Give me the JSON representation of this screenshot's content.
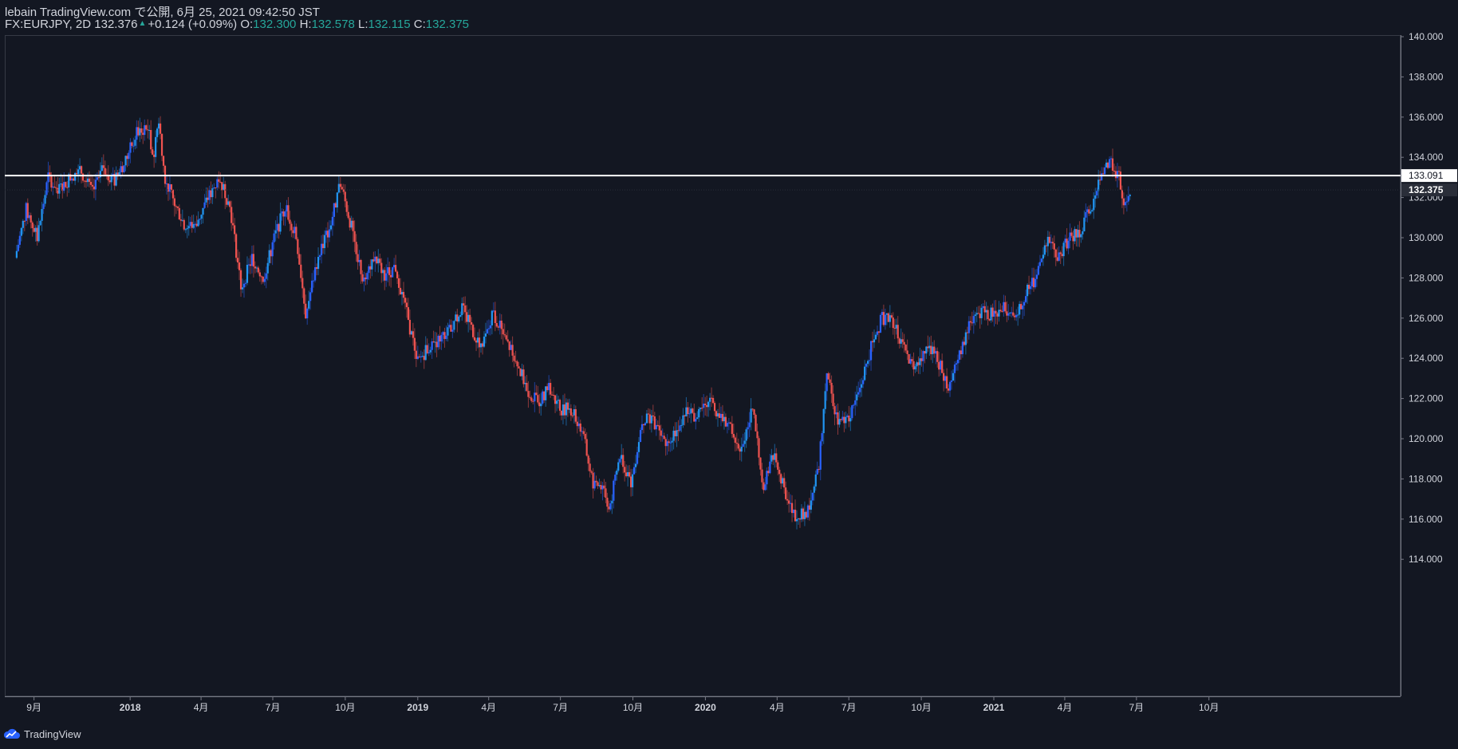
{
  "header": {
    "published_line": "lebain TradingView.com で公開, 6月 25, 2021 09:42:50 JST",
    "symbol": "FX:EURJPY, 2D",
    "last": "132.376",
    "change": "+0.124 (+0.09%)",
    "o_label": "O:",
    "o_value": "132.300",
    "h_label": "H:",
    "h_value": "132.578",
    "l_label": "L:",
    "l_value": "132.115",
    "c_label": "C:",
    "c_value": "132.375"
  },
  "footer": {
    "brand": "TradingView"
  },
  "colors": {
    "background": "#131722",
    "up": "#2962ff",
    "up_alt": "#2196f3",
    "down": "#ef5350",
    "text": "#d1d4dc",
    "teal": "#26a69a",
    "hline": "#ffffff"
  },
  "chart_data": {
    "type": "candlestick",
    "symbol": "FX:EURJPY",
    "interval": "2D",
    "ylim": [
      112.5,
      140.5
    ],
    "y_ticks": [
      "140.000",
      "138.000",
      "136.000",
      "134.000",
      "132.000",
      "130.000",
      "128.000",
      "126.000",
      "124.000",
      "122.000",
      "120.000",
      "118.000",
      "116.000",
      "114.000"
    ],
    "x_ticks": [
      {
        "label": "9月",
        "date": "2017-09",
        "bold": false
      },
      {
        "label": "2018",
        "date": "2018-01",
        "bold": true
      },
      {
        "label": "4月",
        "date": "2018-04",
        "bold": false
      },
      {
        "label": "7月",
        "date": "2018-07",
        "bold": false
      },
      {
        "label": "10月",
        "date": "2018-10",
        "bold": false
      },
      {
        "label": "2019",
        "date": "2019-01",
        "bold": true
      },
      {
        "label": "4月",
        "date": "2019-04",
        "bold": false
      },
      {
        "label": "7月",
        "date": "2019-07",
        "bold": false
      },
      {
        "label": "10月",
        "date": "2019-10",
        "bold": false
      },
      {
        "label": "2020",
        "date": "2020-01",
        "bold": true
      },
      {
        "label": "4月",
        "date": "2020-04",
        "bold": false
      },
      {
        "label": "7月",
        "date": "2020-07",
        "bold": false
      },
      {
        "label": "10月",
        "date": "2020-10",
        "bold": false
      },
      {
        "label": "2021",
        "date": "2021-01",
        "bold": true
      },
      {
        "label": "4月",
        "date": "2021-04",
        "bold": false
      },
      {
        "label": "7月",
        "date": "2021-07",
        "bold": false
      },
      {
        "label": "10月",
        "date": "2021-10",
        "bold": false
      }
    ],
    "horizontal_line": {
      "value": 133.091,
      "label": "133.091"
    },
    "last_price": {
      "value": 132.375,
      "label": "132.375"
    },
    "anchors": [
      [
        "2017-08-10",
        129.0
      ],
      [
        "2017-08-24",
        131.4
      ],
      [
        "2017-09-07",
        130.0
      ],
      [
        "2017-09-21",
        133.0
      ],
      [
        "2017-10-05",
        132.4
      ],
      [
        "2017-10-19",
        133.0
      ],
      [
        "2017-11-02",
        133.3
      ],
      [
        "2017-11-16",
        132.2
      ],
      [
        "2017-11-30",
        133.5
      ],
      [
        "2017-12-14",
        132.8
      ],
      [
        "2017-12-28",
        133.8
      ],
      [
        "2018-01-11",
        135.2
      ],
      [
        "2018-01-25",
        135.5
      ],
      [
        "2018-02-02",
        134.0
      ],
      [
        "2018-02-08",
        136.0
      ],
      [
        "2018-02-16",
        133.0
      ],
      [
        "2018-03-01",
        131.6
      ],
      [
        "2018-03-15",
        130.5
      ],
      [
        "2018-03-29",
        130.8
      ],
      [
        "2018-04-12",
        132.0
      ],
      [
        "2018-04-26",
        133.0
      ],
      [
        "2018-05-10",
        131.5
      ],
      [
        "2018-05-24",
        127.5
      ],
      [
        "2018-06-07",
        129.0
      ],
      [
        "2018-06-21",
        128.0
      ],
      [
        "2018-07-05",
        130.0
      ],
      [
        "2018-07-19",
        131.6
      ],
      [
        "2018-08-02",
        130.0
      ],
      [
        "2018-08-14",
        126.2
      ],
      [
        "2018-08-30",
        129.2
      ],
      [
        "2018-09-13",
        130.5
      ],
      [
        "2018-09-27",
        132.7
      ],
      [
        "2018-10-11",
        130.5
      ],
      [
        "2018-10-25",
        128.0
      ],
      [
        "2018-11-08",
        129.0
      ],
      [
        "2018-11-22",
        128.2
      ],
      [
        "2018-12-06",
        128.5
      ],
      [
        "2018-12-20",
        126.2
      ],
      [
        "2019-01-03",
        123.8
      ],
      [
        "2019-01-17",
        124.6
      ],
      [
        "2019-01-31",
        125.0
      ],
      [
        "2019-02-14",
        125.5
      ],
      [
        "2019-02-28",
        126.5
      ],
      [
        "2019-03-12",
        125.5
      ],
      [
        "2019-03-26",
        124.5
      ],
      [
        "2019-04-09",
        126.3
      ],
      [
        "2019-04-23",
        125.0
      ],
      [
        "2019-05-07",
        124.0
      ],
      [
        "2019-05-21",
        122.5
      ],
      [
        "2019-06-04",
        121.8
      ],
      [
        "2019-06-18",
        122.5
      ],
      [
        "2019-07-02",
        121.5
      ],
      [
        "2019-07-16",
        121.5
      ],
      [
        "2019-07-30",
        120.5
      ],
      [
        "2019-08-13",
        117.8
      ],
      [
        "2019-08-27",
        117.6
      ],
      [
        "2019-09-03",
        116.5
      ],
      [
        "2019-09-17",
        119.2
      ],
      [
        "2019-10-01",
        117.8
      ],
      [
        "2019-10-15",
        121.0
      ],
      [
        "2019-10-29",
        120.8
      ],
      [
        "2019-11-12",
        119.8
      ],
      [
        "2019-11-26",
        120.4
      ],
      [
        "2019-12-10",
        121.5
      ],
      [
        "2019-12-24",
        121.0
      ],
      [
        "2020-01-07",
        122.0
      ],
      [
        "2020-01-21",
        121.0
      ],
      [
        "2020-02-04",
        120.5
      ],
      [
        "2020-02-18",
        119.5
      ],
      [
        "2020-03-03",
        121.5
      ],
      [
        "2020-03-17",
        117.5
      ],
      [
        "2020-03-31",
        119.5
      ],
      [
        "2020-04-14",
        117.0
      ],
      [
        "2020-04-28",
        116.0
      ],
      [
        "2020-05-12",
        116.5
      ],
      [
        "2020-05-26",
        118.5
      ],
      [
        "2020-06-05",
        123.5
      ],
      [
        "2020-06-19",
        120.8
      ],
      [
        "2020-07-03",
        121.0
      ],
      [
        "2020-07-17",
        122.5
      ],
      [
        "2020-07-31",
        124.5
      ],
      [
        "2020-08-14",
        126.0
      ],
      [
        "2020-08-28",
        125.8
      ],
      [
        "2020-09-11",
        124.5
      ],
      [
        "2020-09-25",
        123.3
      ],
      [
        "2020-10-09",
        124.6
      ],
      [
        "2020-10-23",
        124.0
      ],
      [
        "2020-11-06",
        122.5
      ],
      [
        "2020-11-20",
        124.0
      ],
      [
        "2020-12-04",
        126.0
      ],
      [
        "2020-12-18",
        126.3
      ],
      [
        "2021-01-01",
        126.2
      ],
      [
        "2021-01-15",
        126.5
      ],
      [
        "2021-01-29",
        125.8
      ],
      [
        "2021-02-12",
        127.2
      ],
      [
        "2021-02-26",
        128.0
      ],
      [
        "2021-03-12",
        129.8
      ],
      [
        "2021-03-26",
        129.0
      ],
      [
        "2021-04-09",
        130.0
      ],
      [
        "2021-04-23",
        130.4
      ],
      [
        "2021-05-07",
        131.5
      ],
      [
        "2021-05-21",
        133.2
      ],
      [
        "2021-05-28",
        133.8
      ],
      [
        "2021-06-04",
        133.5
      ],
      [
        "2021-06-11",
        133.0
      ],
      [
        "2021-06-17",
        131.3
      ],
      [
        "2021-06-24",
        132.375
      ]
    ]
  }
}
